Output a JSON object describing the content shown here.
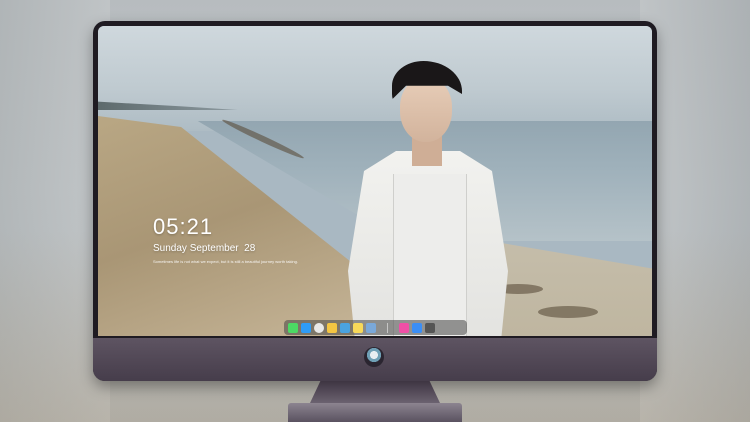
{
  "lock_screen": {
    "time": "05:21",
    "date": "Sunday September  28",
    "motto": "Sometimes life is not what we expect, but it is still a beautiful journey worth taking."
  },
  "dock": {
    "apps": [
      {
        "name": "messages-icon",
        "color": "#4cd964"
      },
      {
        "name": "finder-icon",
        "color": "#2f9cf6"
      },
      {
        "name": "safari-icon",
        "color": "#e8e8e8"
      },
      {
        "name": "photos-icon",
        "color": "#f4c542"
      },
      {
        "name": "video-icon",
        "color": "#4aa3df"
      },
      {
        "name": "notes-icon",
        "color": "#f8d959"
      },
      {
        "name": "preview-icon",
        "color": "#7aa8d9"
      },
      {
        "name": "music-icon",
        "color": "#ef4fa6"
      },
      {
        "name": "app-store-icon",
        "color": "#3b8ef5"
      },
      {
        "name": "camera-icon",
        "color": "#555555"
      }
    ]
  },
  "colors": {
    "bezel": "#1f1b22",
    "chin": "#5e5462"
  }
}
